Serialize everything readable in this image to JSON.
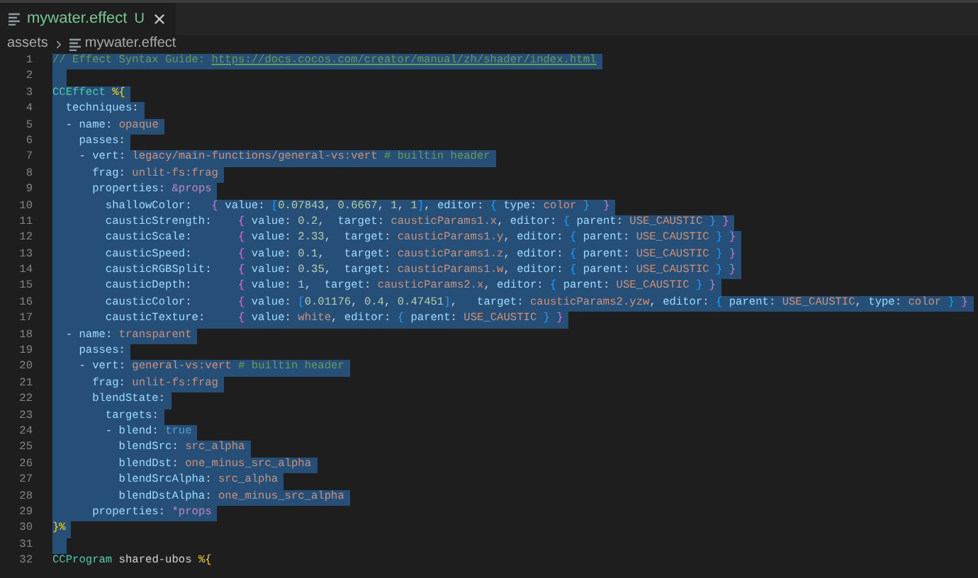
{
  "tab": {
    "label": "mywater.effect",
    "badge": "U",
    "selected": true
  },
  "breadcrumbs": [
    "assets",
    "mywater.effect"
  ],
  "lines": [
    {
      "n": "1",
      "selected": true,
      "tokens": [
        {
          "kind": "c",
          "text": "// Effect Syntax Guide: "
        },
        {
          "kind": "u",
          "text": "https://docs.cocos.com/creator/manual/zh/shader/index.html"
        }
      ]
    },
    {
      "n": "2",
      "selected": true
    },
    {
      "n": "3",
      "selected": true,
      "tokens": [
        {
          "kind": "t",
          "text": "CCEffect"
        },
        {
          "kind": "b1",
          "text": " %{"
        }
      ]
    },
    {
      "n": "4",
      "selected": true,
      "tokens": [
        {
          "kind": "k",
          "text": "  techniques"
        },
        {
          "kind": "p",
          "text": ":"
        }
      ]
    },
    {
      "n": "5",
      "selected": true,
      "tokens": [
        {
          "kind": "p",
          "text": "  -"
        },
        {
          "kind": "k",
          "text": " name"
        },
        {
          "kind": "p",
          "text": ": "
        },
        {
          "kind": "v",
          "text": "opaque"
        }
      ]
    },
    {
      "n": "6",
      "selected": true,
      "tokens": [
        {
          "kind": "k",
          "text": "    passes"
        },
        {
          "kind": "p",
          "text": ":"
        }
      ]
    },
    {
      "n": "7",
      "selected": true,
      "tokens": [
        {
          "kind": "p",
          "text": "    -"
        },
        {
          "kind": "k",
          "text": " vert"
        },
        {
          "kind": "p",
          "text": ": "
        },
        {
          "kind": "v",
          "text": "legacy/main-functions/general-vs:vert"
        },
        {
          "kind": "c",
          "text": " # builtin header"
        }
      ]
    },
    {
      "n": "8",
      "selected": true,
      "tokens": [
        {
          "kind": "k",
          "text": "      frag"
        },
        {
          "kind": "p",
          "text": ": "
        },
        {
          "kind": "v",
          "text": "unlit-fs:frag"
        }
      ]
    },
    {
      "n": "9",
      "selected": true,
      "tokens": [
        {
          "kind": "k",
          "text": "      properties"
        },
        {
          "kind": "p",
          "text": ": "
        },
        {
          "kind": "a",
          "text": "&props"
        }
      ]
    },
    {
      "n": "10",
      "selected": true,
      "tokens": [
        {
          "kind": "k",
          "text": "        shallowColor"
        },
        {
          "kind": "p",
          "text": ":   "
        },
        {
          "kind": "b2",
          "text": "{"
        },
        {
          "kind": "k",
          "text": " value"
        },
        {
          "kind": "p",
          "text": ": "
        },
        {
          "kind": "b3",
          "text": "["
        },
        {
          "kind": "n",
          "text": "0.07843"
        },
        {
          "kind": "p",
          "text": ", "
        },
        {
          "kind": "n",
          "text": "0.6667"
        },
        {
          "kind": "p",
          "text": ", "
        },
        {
          "kind": "n",
          "text": "1"
        },
        {
          "kind": "p",
          "text": ", "
        },
        {
          "kind": "n",
          "text": "1"
        },
        {
          "kind": "b3",
          "text": "]"
        },
        {
          "kind": "p",
          "text": ", "
        },
        {
          "kind": "k",
          "text": "editor"
        },
        {
          "kind": "p",
          "text": ": "
        },
        {
          "kind": "b3",
          "text": "{"
        },
        {
          "kind": "k",
          "text": " type"
        },
        {
          "kind": "p",
          "text": ": "
        },
        {
          "kind": "v",
          "text": "color"
        },
        {
          "kind": "b3",
          "text": " }"
        },
        {
          "kind": "b2",
          "text": "  }"
        }
      ]
    },
    {
      "n": "11",
      "selected": true,
      "tokens": [
        {
          "kind": "k",
          "text": "        causticStrength"
        },
        {
          "kind": "p",
          "text": ":    "
        },
        {
          "kind": "b2",
          "text": "{"
        },
        {
          "kind": "k",
          "text": " value"
        },
        {
          "kind": "p",
          "text": ": "
        },
        {
          "kind": "n",
          "text": "0.2"
        },
        {
          "kind": "p",
          "text": ",  "
        },
        {
          "kind": "k",
          "text": "target"
        },
        {
          "kind": "p",
          "text": ": "
        },
        {
          "kind": "v",
          "text": "causticParams1.x"
        },
        {
          "kind": "p",
          "text": ", "
        },
        {
          "kind": "k",
          "text": "editor"
        },
        {
          "kind": "p",
          "text": ": "
        },
        {
          "kind": "b3",
          "text": "{"
        },
        {
          "kind": "k",
          "text": " parent"
        },
        {
          "kind": "p",
          "text": ": "
        },
        {
          "kind": "v",
          "text": "USE_CAUSTIC"
        },
        {
          "kind": "b3",
          "text": " }"
        },
        {
          "kind": "b2",
          "text": " }"
        }
      ]
    },
    {
      "n": "12",
      "selected": true,
      "tokens": [
        {
          "kind": "k",
          "text": "        causticScale"
        },
        {
          "kind": "p",
          "text": ":       "
        },
        {
          "kind": "b2",
          "text": "{"
        },
        {
          "kind": "k",
          "text": " value"
        },
        {
          "kind": "p",
          "text": ": "
        },
        {
          "kind": "n",
          "text": "2.33"
        },
        {
          "kind": "p",
          "text": ",  "
        },
        {
          "kind": "k",
          "text": "target"
        },
        {
          "kind": "p",
          "text": ": "
        },
        {
          "kind": "v",
          "text": "causticParams1.y"
        },
        {
          "kind": "p",
          "text": ", "
        },
        {
          "kind": "k",
          "text": "editor"
        },
        {
          "kind": "p",
          "text": ": "
        },
        {
          "kind": "b3",
          "text": "{"
        },
        {
          "kind": "k",
          "text": " parent"
        },
        {
          "kind": "p",
          "text": ": "
        },
        {
          "kind": "v",
          "text": "USE_CAUSTIC"
        },
        {
          "kind": "b3",
          "text": " }"
        },
        {
          "kind": "b2",
          "text": " }"
        }
      ]
    },
    {
      "n": "13",
      "selected": true,
      "tokens": [
        {
          "kind": "k",
          "text": "        causticSpeed"
        },
        {
          "kind": "p",
          "text": ":       "
        },
        {
          "kind": "b2",
          "text": "{"
        },
        {
          "kind": "k",
          "text": " value"
        },
        {
          "kind": "p",
          "text": ": "
        },
        {
          "kind": "n",
          "text": "0.1"
        },
        {
          "kind": "p",
          "text": ",   "
        },
        {
          "kind": "k",
          "text": "target"
        },
        {
          "kind": "p",
          "text": ": "
        },
        {
          "kind": "v",
          "text": "causticParams1.z"
        },
        {
          "kind": "p",
          "text": ", "
        },
        {
          "kind": "k",
          "text": "editor"
        },
        {
          "kind": "p",
          "text": ": "
        },
        {
          "kind": "b3",
          "text": "{"
        },
        {
          "kind": "k",
          "text": " parent"
        },
        {
          "kind": "p",
          "text": ": "
        },
        {
          "kind": "v",
          "text": "USE_CAUSTIC"
        },
        {
          "kind": "b3",
          "text": " }"
        },
        {
          "kind": "b2",
          "text": " }"
        }
      ]
    },
    {
      "n": "14",
      "selected": true,
      "tokens": [
        {
          "kind": "k",
          "text": "        causticRGBSplit"
        },
        {
          "kind": "p",
          "text": ":    "
        },
        {
          "kind": "b2",
          "text": "{"
        },
        {
          "kind": "k",
          "text": " value"
        },
        {
          "kind": "p",
          "text": ": "
        },
        {
          "kind": "n",
          "text": "0.35"
        },
        {
          "kind": "p",
          "text": ",  "
        },
        {
          "kind": "k",
          "text": "target"
        },
        {
          "kind": "p",
          "text": ": "
        },
        {
          "kind": "v",
          "text": "causticParams1.w"
        },
        {
          "kind": "p",
          "text": ", "
        },
        {
          "kind": "k",
          "text": "editor"
        },
        {
          "kind": "p",
          "text": ": "
        },
        {
          "kind": "b3",
          "text": "{"
        },
        {
          "kind": "k",
          "text": " parent"
        },
        {
          "kind": "p",
          "text": ": "
        },
        {
          "kind": "v",
          "text": "USE_CAUSTIC"
        },
        {
          "kind": "b3",
          "text": " }"
        },
        {
          "kind": "b2",
          "text": " }"
        }
      ]
    },
    {
      "n": "15",
      "selected": true,
      "tokens": [
        {
          "kind": "k",
          "text": "        causticDepth"
        },
        {
          "kind": "p",
          "text": ":       "
        },
        {
          "kind": "b2",
          "text": "{"
        },
        {
          "kind": "k",
          "text": " value"
        },
        {
          "kind": "p",
          "text": ": "
        },
        {
          "kind": "n",
          "text": "1"
        },
        {
          "kind": "p",
          "text": ",  "
        },
        {
          "kind": "k",
          "text": "target"
        },
        {
          "kind": "p",
          "text": ": "
        },
        {
          "kind": "v",
          "text": "causticParams2.x"
        },
        {
          "kind": "p",
          "text": ", "
        },
        {
          "kind": "k",
          "text": "editor"
        },
        {
          "kind": "p",
          "text": ": "
        },
        {
          "kind": "b3",
          "text": "{"
        },
        {
          "kind": "k",
          "text": " parent"
        },
        {
          "kind": "p",
          "text": ": "
        },
        {
          "kind": "v",
          "text": "USE_CAUSTIC"
        },
        {
          "kind": "b3",
          "text": " }"
        },
        {
          "kind": "b2",
          "text": " }"
        }
      ]
    },
    {
      "n": "16",
      "selected": true,
      "tokens": [
        {
          "kind": "k",
          "text": "        causticColor"
        },
        {
          "kind": "p",
          "text": ":       "
        },
        {
          "kind": "b2",
          "text": "{"
        },
        {
          "kind": "k",
          "text": " value"
        },
        {
          "kind": "p",
          "text": ": "
        },
        {
          "kind": "b3",
          "text": "["
        },
        {
          "kind": "n",
          "text": "0.01176"
        },
        {
          "kind": "p",
          "text": ", "
        },
        {
          "kind": "n",
          "text": "0.4"
        },
        {
          "kind": "p",
          "text": ", "
        },
        {
          "kind": "n",
          "text": "0.47451"
        },
        {
          "kind": "b3",
          "text": "]"
        },
        {
          "kind": "p",
          "text": ",   "
        },
        {
          "kind": "k",
          "text": "target"
        },
        {
          "kind": "p",
          "text": ": "
        },
        {
          "kind": "v",
          "text": "causticParams2.yzw"
        },
        {
          "kind": "p",
          "text": ", "
        },
        {
          "kind": "k",
          "text": "editor"
        },
        {
          "kind": "p",
          "text": ": "
        },
        {
          "kind": "b3",
          "text": "{"
        },
        {
          "kind": "k",
          "text": " parent"
        },
        {
          "kind": "p",
          "text": ": "
        },
        {
          "kind": "v",
          "text": "USE_CAUSTIC"
        },
        {
          "kind": "p",
          "text": ", "
        },
        {
          "kind": "k",
          "text": "type"
        },
        {
          "kind": "p",
          "text": ": "
        },
        {
          "kind": "v",
          "text": "color"
        },
        {
          "kind": "b3",
          "text": " }"
        },
        {
          "kind": "b2",
          "text": " }"
        }
      ]
    },
    {
      "n": "17",
      "selected": true,
      "tokens": [
        {
          "kind": "k",
          "text": "        causticTexture"
        },
        {
          "kind": "p",
          "text": ":     "
        },
        {
          "kind": "b2",
          "text": "{"
        },
        {
          "kind": "k",
          "text": " value"
        },
        {
          "kind": "p",
          "text": ": "
        },
        {
          "kind": "v",
          "text": "white"
        },
        {
          "kind": "p",
          "text": ", "
        },
        {
          "kind": "k",
          "text": "editor"
        },
        {
          "kind": "p",
          "text": ": "
        },
        {
          "kind": "b3",
          "text": "{"
        },
        {
          "kind": "k",
          "text": " parent"
        },
        {
          "kind": "p",
          "text": ": "
        },
        {
          "kind": "v",
          "text": "USE_CAUSTIC"
        },
        {
          "kind": "b3",
          "text": " }"
        },
        {
          "kind": "b2",
          "text": " }"
        }
      ]
    },
    {
      "n": "18",
      "selected": true,
      "tokens": [
        {
          "kind": "p",
          "text": "  -"
        },
        {
          "kind": "k",
          "text": " name"
        },
        {
          "kind": "p",
          "text": ": "
        },
        {
          "kind": "v",
          "text": "transparent"
        }
      ]
    },
    {
      "n": "19",
      "selected": true,
      "tokens": [
        {
          "kind": "k",
          "text": "    passes"
        },
        {
          "kind": "p",
          "text": ":"
        }
      ]
    },
    {
      "n": "20",
      "selected": true,
      "tokens": [
        {
          "kind": "p",
          "text": "    -"
        },
        {
          "kind": "k",
          "text": " vert"
        },
        {
          "kind": "p",
          "text": ": "
        },
        {
          "kind": "v",
          "text": "general-vs:vert"
        },
        {
          "kind": "c",
          "text": " # builtin header"
        }
      ]
    },
    {
      "n": "21",
      "selected": true,
      "tokens": [
        {
          "kind": "k",
          "text": "      frag"
        },
        {
          "kind": "p",
          "text": ": "
        },
        {
          "kind": "v",
          "text": "unlit-fs:frag"
        }
      ]
    },
    {
      "n": "22",
      "selected": true,
      "tokens": [
        {
          "kind": "k",
          "text": "      blendState"
        },
        {
          "kind": "p",
          "text": ":"
        }
      ]
    },
    {
      "n": "23",
      "selected": true,
      "tokens": [
        {
          "kind": "k",
          "text": "        targets"
        },
        {
          "kind": "p",
          "text": ":"
        }
      ]
    },
    {
      "n": "24",
      "selected": true,
      "tokens": [
        {
          "kind": "p",
          "text": "        -"
        },
        {
          "kind": "k",
          "text": " blend"
        },
        {
          "kind": "p",
          "text": ": "
        },
        {
          "kind": "t2",
          "text": "true"
        }
      ]
    },
    {
      "n": "25",
      "selected": true,
      "tokens": [
        {
          "kind": "k",
          "text": "          blendSrc"
        },
        {
          "kind": "p",
          "text": ": "
        },
        {
          "kind": "v",
          "text": "src_alpha"
        }
      ]
    },
    {
      "n": "26",
      "selected": true,
      "tokens": [
        {
          "kind": "k",
          "text": "          blendDst"
        },
        {
          "kind": "p",
          "text": ": "
        },
        {
          "kind": "v",
          "text": "one_minus_src_alpha"
        }
      ]
    },
    {
      "n": "27",
      "selected": true,
      "tokens": [
        {
          "kind": "k",
          "text": "          blendSrcAlpha"
        },
        {
          "kind": "p",
          "text": ": "
        },
        {
          "kind": "v",
          "text": "src_alpha"
        }
      ]
    },
    {
      "n": "28",
      "selected": true,
      "tokens": [
        {
          "kind": "k",
          "text": "          blendDstAlpha"
        },
        {
          "kind": "p",
          "text": ": "
        },
        {
          "kind": "v",
          "text": "one_minus_src_alpha"
        }
      ]
    },
    {
      "n": "29",
      "selected": true,
      "tokens": [
        {
          "kind": "k",
          "text": "      properties"
        },
        {
          "kind": "p",
          "text": ": "
        },
        {
          "kind": "a",
          "text": "*props"
        }
      ]
    },
    {
      "n": "30",
      "selected": true,
      "tokens": [
        {
          "kind": "b1",
          "text": "}%"
        }
      ]
    },
    {
      "n": "31",
      "selected": true
    },
    {
      "n": "32",
      "selected": false,
      "tokens": [
        {
          "kind": "t",
          "text": "CCProgram"
        },
        {
          "kind": "p",
          "text": " shared-ubos"
        },
        {
          "kind": "b1",
          "text": " %{"
        }
      ]
    }
  ]
}
